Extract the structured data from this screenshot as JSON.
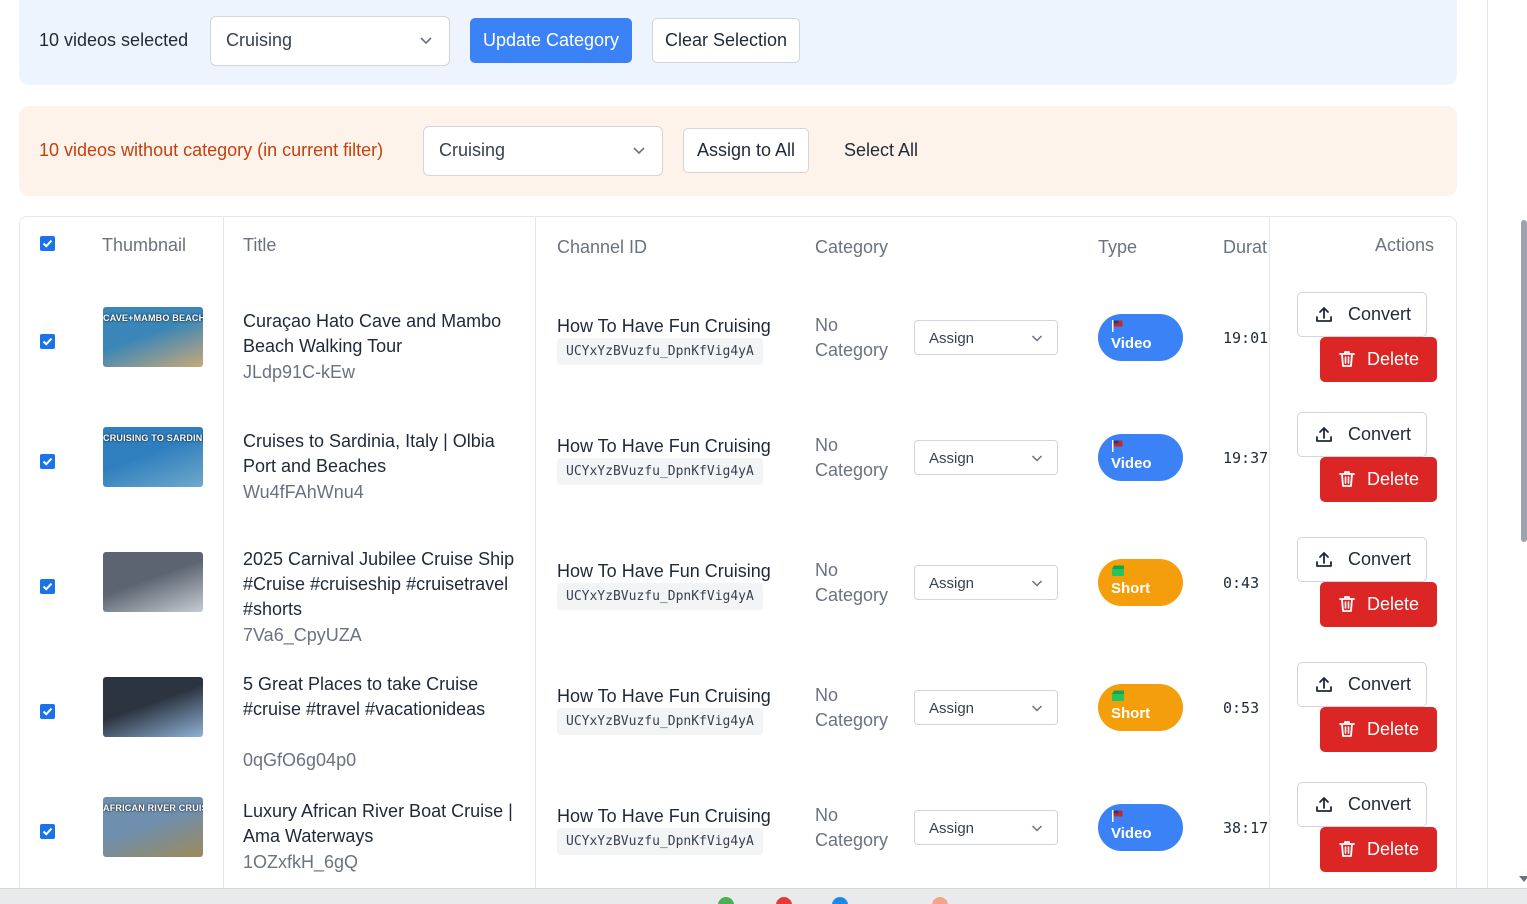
{
  "bulk": {
    "selected_text": "10 videos selected",
    "category_value": "Cruising",
    "update_label": "Update Category",
    "clear_label": "Clear Selection"
  },
  "uncategorized": {
    "message": "10 videos without category (in current filter)",
    "category_value": "Cruising",
    "assign_all_label": "Assign to All",
    "select_all_label": "Select All"
  },
  "table": {
    "headers": {
      "thumbnail": "Thumbnail",
      "title": "Title",
      "channel_id": "Channel ID",
      "category": "Category",
      "type": "Type",
      "duration": "Durat",
      "actions": "Actions"
    },
    "rows": [
      {
        "checked": true,
        "thumb_caption": "CAVE+MAMBO BEACH",
        "thumb_colors": [
          "#3a86b8",
          "#c8a878"
        ],
        "title": "Curaçao Hato Cave and Mambo Beach Walking Tour",
        "video_id": "JLdp91C-kEw",
        "channel": "How To Have Fun Cruising",
        "channel_id": "UCYxYzBVuzfu_DpnKfVig4yA",
        "category": "No Category",
        "assign_label": "Assign",
        "type": "Video",
        "duration": "19:01",
        "convert_label": "Convert",
        "delete_label": "Delete"
      },
      {
        "checked": true,
        "thumb_caption": "CRUISING TO SARDINIA",
        "thumb_colors": [
          "#2f7fbf",
          "#6fa9c9"
        ],
        "title": "Cruises to Sardinia, Italy | Olbia Port and Beaches",
        "video_id": "Wu4fFAhWnu4",
        "channel": "How To Have Fun Cruising",
        "channel_id": "UCYxYzBVuzfu_DpnKfVig4yA",
        "category": "No Category",
        "assign_label": "Assign",
        "type": "Video",
        "duration": "19:37",
        "convert_label": "Convert",
        "delete_label": "Delete"
      },
      {
        "checked": true,
        "thumb_caption": "",
        "thumb_colors": [
          "#5b6470",
          "#c7ccd3"
        ],
        "title": "2025 Carnival Jubilee Cruise Ship #Cruise #cruiseship #cruisetravel #shorts",
        "video_id": "7Va6_CpyUZA",
        "channel": "How To Have Fun Cruising",
        "channel_id": "UCYxYzBVuzfu_DpnKfVig4yA",
        "category": "No Category",
        "assign_label": "Assign",
        "type": "Short",
        "duration": "0:43",
        "convert_label": "Convert",
        "delete_label": "Delete"
      },
      {
        "checked": true,
        "thumb_caption": "",
        "thumb_colors": [
          "#2c3440",
          "#8fb2d6"
        ],
        "title": "5 Great Places to take Cruise #cruise #travel #vacationideas",
        "video_id": "0qGfO6g04p0",
        "channel": "How To Have Fun Cruising",
        "channel_id": "UCYxYzBVuzfu_DpnKfVig4yA",
        "category": "No Category",
        "assign_label": "Assign",
        "type": "Short",
        "duration": "0:53",
        "convert_label": "Convert",
        "delete_label": "Delete"
      },
      {
        "checked": true,
        "thumb_caption": "AFRICAN RIVER CRUISE",
        "thumb_colors": [
          "#6e8fae",
          "#9c8a5a"
        ],
        "title": "Luxury African River Boat Cruise | Ama Waterways",
        "video_id": "1OZxfkH_6gQ",
        "channel": "How To Have Fun Cruising",
        "channel_id": "UCYxYzBVuzfu_DpnKfVig4yA",
        "category": "No Category",
        "assign_label": "Assign",
        "type": "Video",
        "duration": "38:17",
        "convert_label": "Convert",
        "delete_label": "Delete"
      }
    ]
  }
}
